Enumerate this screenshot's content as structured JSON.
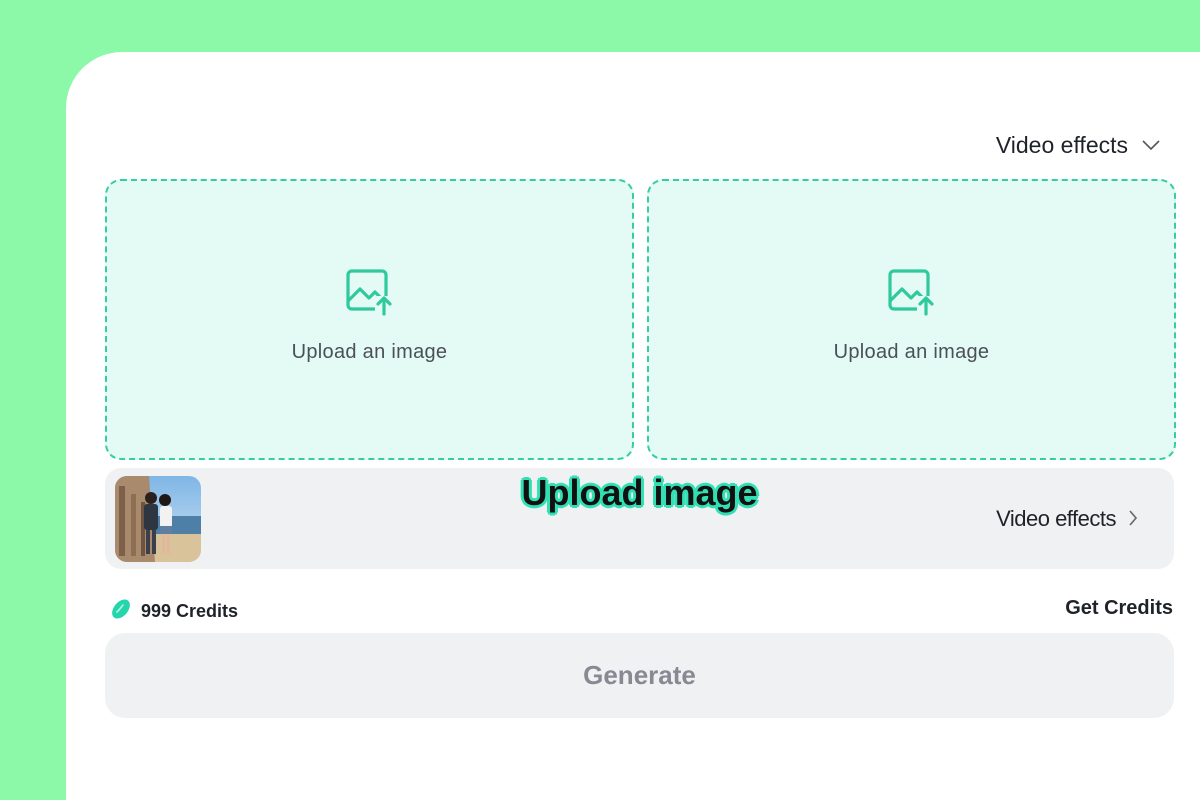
{
  "header": {
    "effects_dropdown_label": "Video effects",
    "chevron_icon": "chevron-down-icon"
  },
  "upload": {
    "slots": [
      {
        "label": "Upload an image",
        "icon": "image-upload-icon"
      },
      {
        "label": "Upload an image",
        "icon": "image-upload-icon"
      }
    ]
  },
  "effect_row": {
    "overlay_title": "Upload image",
    "thumbnail": "couple-beach-photo",
    "link_label": "Video effects",
    "link_icon": "chevron-right-icon"
  },
  "credits": {
    "icon": "bean-icon",
    "label": "999 Credits",
    "get_credits_label": "Get Credits"
  },
  "generate": {
    "label": "Generate"
  },
  "colors": {
    "background": "#8cf9a9",
    "accent": "#36cda2",
    "upload_fill": "#e4fbf5",
    "row_fill": "#f0f1f3",
    "disabled_text": "#868a93"
  }
}
